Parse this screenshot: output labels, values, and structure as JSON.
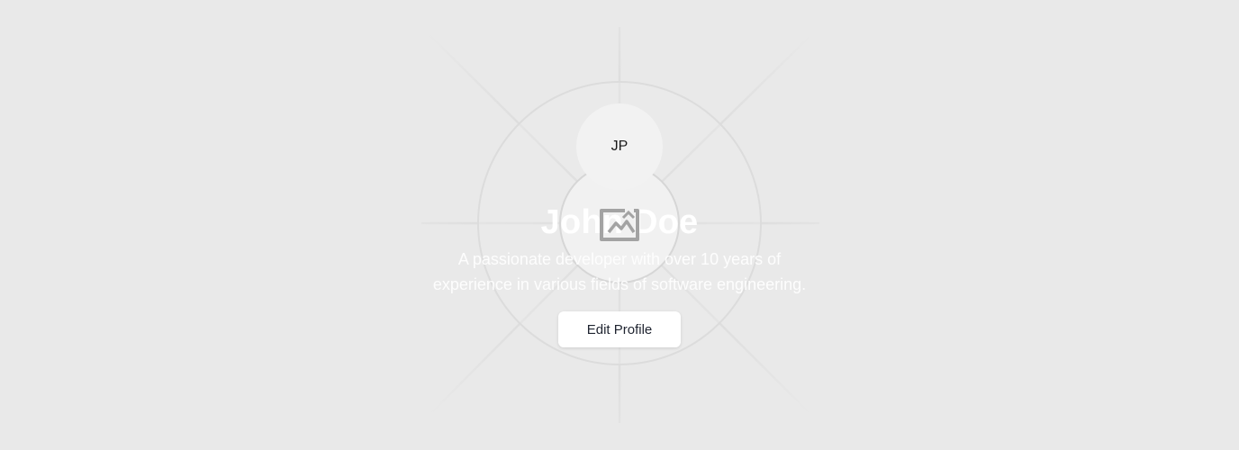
{
  "profile": {
    "initials": "JP",
    "name": "John Doe",
    "bio_line1": "A passionate developer with over 10 years of",
    "bio_line2": "experience in various fields of software engineering."
  },
  "actions": {
    "edit_label": "Edit Profile"
  },
  "icons": {
    "placeholder": "broken-image-icon"
  },
  "colors": {
    "background": "#e9e9e9",
    "text_on_background": "#ffffff",
    "button_text": "#1f2430"
  }
}
